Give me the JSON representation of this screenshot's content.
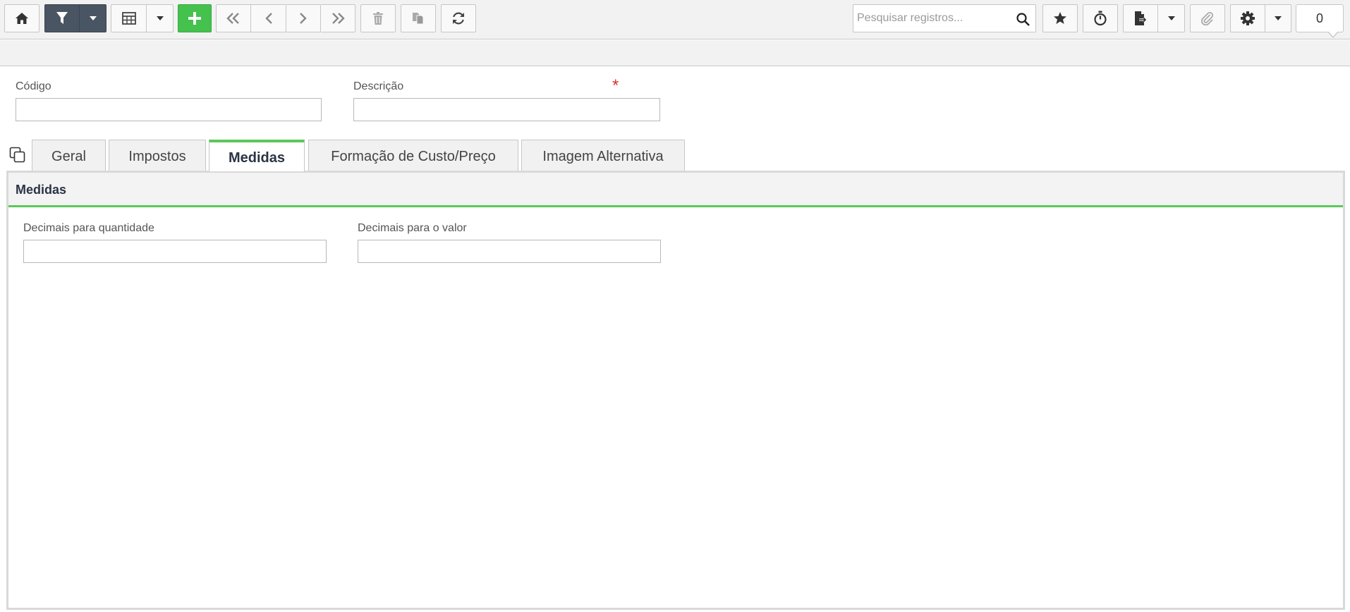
{
  "toolbar": {
    "search": {
      "placeholder": "Pesquisar registros..."
    },
    "counter": "0",
    "icons": [
      "home-icon",
      "filter-icon",
      "caret-down-icon",
      "table-icon",
      "caret-down-icon",
      "plus-icon",
      "double-chevron-left-icon",
      "chevron-left-icon",
      "chevron-right-icon",
      "double-chevron-right-icon",
      "trash-icon",
      "copy-files-icon",
      "refresh-icon",
      "search-icon",
      "star-icon",
      "stopwatch-icon",
      "export-file-icon",
      "caret-down-icon",
      "paperclip-icon",
      "gear-icon",
      "caret-down-icon"
    ],
    "colors": {
      "filter_bg": "#4a5563",
      "add_bg": "#45c14e"
    }
  },
  "form": {
    "codigo_label": "Código",
    "codigo_value": "",
    "descricao_label": "Descrição",
    "descricao_value": "",
    "required_mark": "*"
  },
  "tabs": [
    {
      "label": "Geral",
      "active": false
    },
    {
      "label": "Impostos",
      "active": false
    },
    {
      "label": "Medidas",
      "active": true
    },
    {
      "label": "Formação de Custo/Preço",
      "active": false
    },
    {
      "label": "Imagem Alternativa",
      "active": false
    }
  ],
  "panel": {
    "title": "Medidas",
    "qty_label": "Decimais para quantidade",
    "qty_value": "",
    "value_label": "Decimais para o valor",
    "value_value": "",
    "accent": "#5cc85a"
  }
}
